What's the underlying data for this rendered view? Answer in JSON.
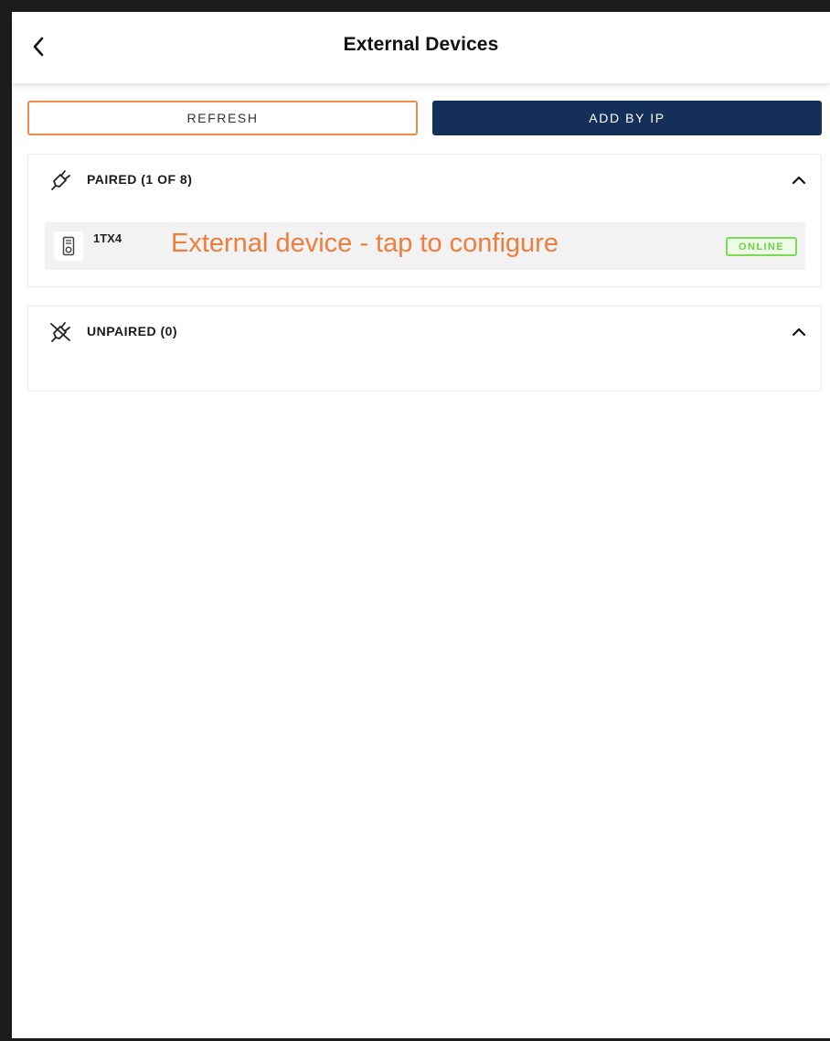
{
  "header": {
    "title": "External Devices",
    "back_icon": "chevron-left-icon"
  },
  "actions": {
    "refresh_label": "REFRESH",
    "add_by_ip_label": "ADD BY IP"
  },
  "paired": {
    "label": "PAIRED (1 OF 8)",
    "icon": "plug-icon",
    "expanded": true,
    "devices": [
      {
        "name": "1TX4",
        "icon": "device-speaker-icon",
        "note": "External device - tap to configure",
        "status": "ONLINE"
      }
    ]
  },
  "unpaired": {
    "label": "UNPAIRED (0)",
    "icon": "plug-off-icon",
    "expanded": true
  },
  "colors": {
    "accent_orange": "#f08a48",
    "note_orange": "#ef7d3c",
    "primary_navy": "#14305a",
    "online_green": "#7ed957"
  }
}
